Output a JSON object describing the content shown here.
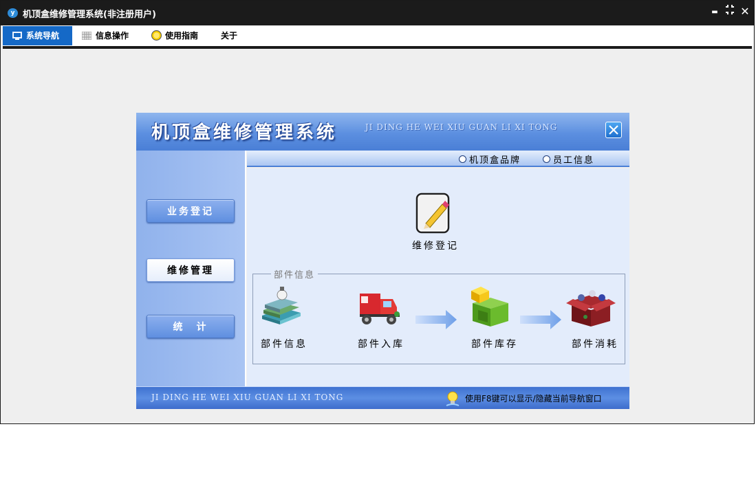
{
  "window": {
    "title": "机顶盒维修管理系统(非注册用户)",
    "logo_text": "y",
    "controls": {
      "minimize": "▬",
      "restore": "⠿",
      "close": "✕"
    }
  },
  "tabs": [
    {
      "label": "系统导航",
      "icon": "monitor-icon",
      "active": true
    },
    {
      "label": "信息操作",
      "icon": "grid-icon",
      "active": false
    },
    {
      "label": "使用指南",
      "icon": "smiley-icon",
      "active": false
    },
    {
      "label": "关于",
      "icon": "",
      "active": false
    }
  ],
  "panel": {
    "title": "机顶盒维修管理系统",
    "subtitle": "JI DING HE WEI XIU GUAN LI XI TONG",
    "nav": [
      {
        "label": "业务登记",
        "style": "blue"
      },
      {
        "label": "维修管理",
        "style": "white"
      },
      {
        "label": "统　计",
        "style": "blue"
      }
    ],
    "radios": [
      {
        "label": "机顶盒品牌"
      },
      {
        "label": "员工信息"
      }
    ],
    "repair": {
      "label": "维修登记",
      "icon": "notepad-pencil-icon"
    },
    "group": {
      "legend": "部件信息",
      "items": [
        {
          "label": "部件信息",
          "icon": "books-icon"
        },
        {
          "label": "部件入库",
          "icon": "truck-icon"
        },
        {
          "label": "部件库存",
          "icon": "boxes-icon"
        },
        {
          "label": "部件消耗",
          "icon": "red-box-icon"
        }
      ]
    },
    "footer": {
      "left": "JI DING HE WEI XIU GUAN LI XI TONG",
      "hint": "使用F8键可以显示/隐藏当前导航窗口"
    }
  },
  "colors": {
    "titlebar": "#1b1b1b",
    "active_tab": "#1569c7",
    "panel_blue": "#5c8fe0",
    "main_bg": "#e3ecfb"
  }
}
